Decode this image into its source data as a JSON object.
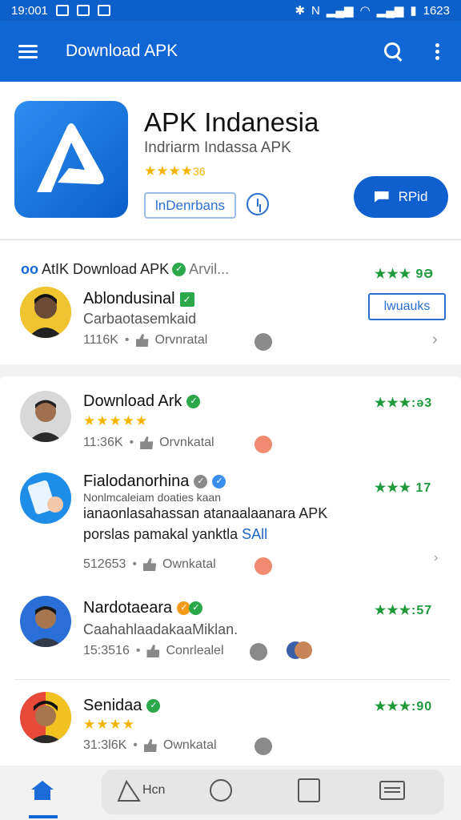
{
  "status_bar": {
    "time_left": "19:001",
    "time_right": "1623"
  },
  "app_bar": {
    "title": "Download APK"
  },
  "app": {
    "name": "APK Indanesia",
    "subtitle": "Indriarm Indassa APK",
    "stars": "★★★★",
    "rating": "36",
    "tag_label": "lnDenrbans",
    "install_label": "RPid"
  },
  "card1": {
    "header_prefix": "oo",
    "header": "AtIK Download APK",
    "header_more": "Arvil...",
    "rating": "★★★ 9Ə",
    "user": "Ablondusinal",
    "desc": "Carbaotasemkaid",
    "count": "1116K",
    "action": "Orvnratal",
    "button": "lwuauks"
  },
  "feed": [
    {
      "name": "Download Ark",
      "rating": "★★★:ə3",
      "stars": "★★★★★",
      "count": "11:36K",
      "action": "Orvnkatal"
    },
    {
      "name": "Fialodanorhina",
      "rating": "★★★ 17",
      "sub": "Nonlmcaleiam doaties kaan",
      "post_line1": "ianaonlasahassan atanaalaanara APK",
      "post_line2": "porslas pamakal yanktla ",
      "post_link": "SAll",
      "count": "512653",
      "action": "Ownkatal"
    },
    {
      "name": "Nardotaeara",
      "rating": "★★★:57",
      "desc": "CaahahlaadakaaMiklan.",
      "count": "15:3516",
      "action": "Conrlealel"
    },
    {
      "name": "Senidaa",
      "rating": "★★★:90",
      "stars": "★★★★",
      "count": "31:3l6K",
      "action": "Ownkatal"
    }
  ],
  "nav": {
    "tent_label": "Hcn"
  }
}
